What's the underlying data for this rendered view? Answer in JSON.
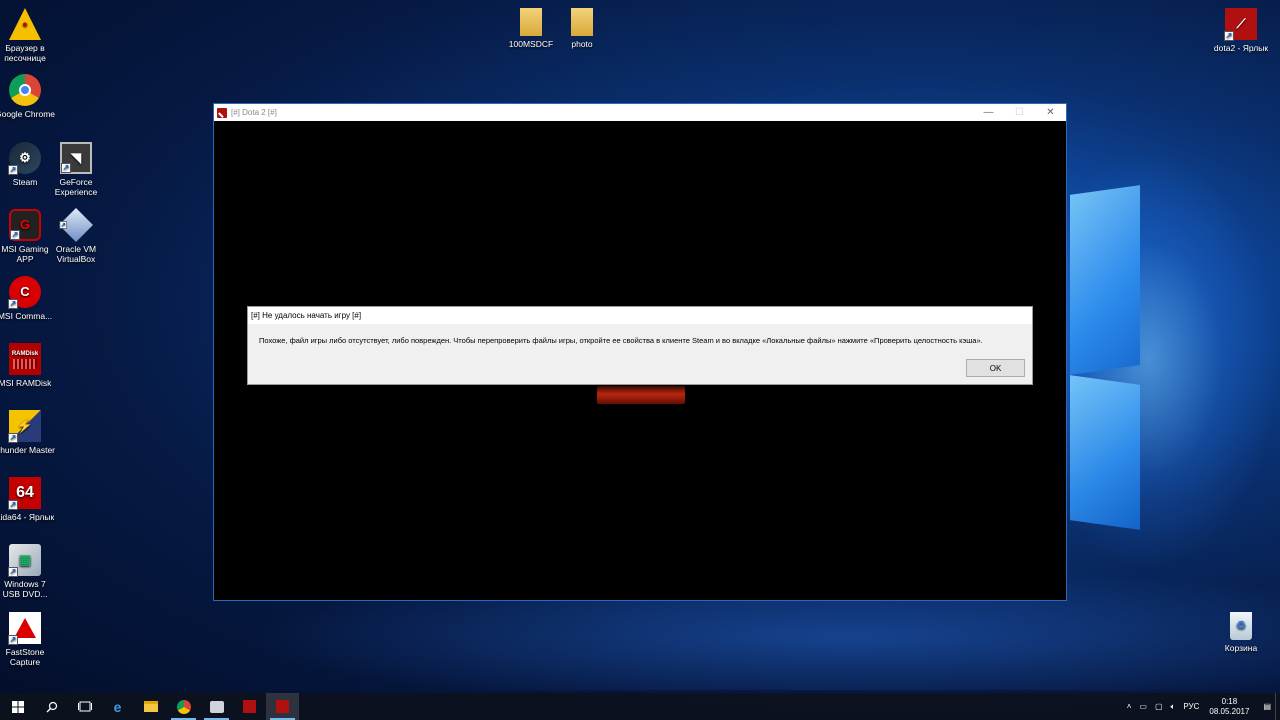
{
  "desktop": {
    "left_icons": [
      {
        "label": "Браузер в песочнице",
        "icon": "sandbox-browser-icon"
      },
      {
        "label": "Google Chrome",
        "icon": "chrome-icon"
      },
      {
        "label": "Steam",
        "icon": "steam-icon"
      },
      {
        "label": "GeForce Experience",
        "icon": "geforce-icon"
      },
      {
        "label": "MSI Gaming APP",
        "icon": "msi-gaming-icon"
      },
      {
        "label": "Oracle VM VirtualBox",
        "icon": "virtualbox-icon"
      },
      {
        "label": "MSI Comma...",
        "icon": "msi-command-icon"
      },
      {
        "label": "MSI RAMDisk",
        "icon": "ramdisk-icon",
        "badge": "RAMDisk"
      },
      {
        "label": "Thunder Master",
        "icon": "thunder-master-icon"
      },
      {
        "label": "aida64 - Ярлык",
        "icon": "aida64-icon",
        "badge": "64"
      },
      {
        "label": "Windows 7 USB DVD...",
        "icon": "win7-usb-icon"
      },
      {
        "label": "FastStone Capture",
        "icon": "faststone-icon"
      }
    ],
    "top_icons": [
      {
        "label": "100MSDCF",
        "icon": "folder-icon"
      },
      {
        "label": "photo",
        "icon": "folder-icon"
      }
    ],
    "right_icons": [
      {
        "label": "dota2 - Ярлык",
        "icon": "dota2-icon"
      },
      {
        "label": "Корзина",
        "icon": "recycle-bin-icon"
      }
    ]
  },
  "game_window": {
    "title": "[#] Dota 2 [#]",
    "minimize": "—",
    "maximize": "☐",
    "close": "✕"
  },
  "dialog": {
    "title": "[#] Не удалось начать игру [#]",
    "message": "Похоже, файл игры либо отсутствует, либо поврежден. Чтобы перепроверить файлы игры, откройте ее свойства в клиенте Steam и во вкладке «Локальные файлы» нажмите «Проверить целостность кэша».",
    "ok_label": "OK"
  },
  "taskbar": {
    "buttons": [
      "start-icon",
      "search-icon",
      "task-view-icon",
      "edge-icon",
      "file-explorer-icon",
      "chrome-icon",
      "app-icon",
      "dota2-icon",
      "dota2-icon"
    ],
    "language": "РУС",
    "time": "0:18",
    "date": "08.05.2017"
  }
}
